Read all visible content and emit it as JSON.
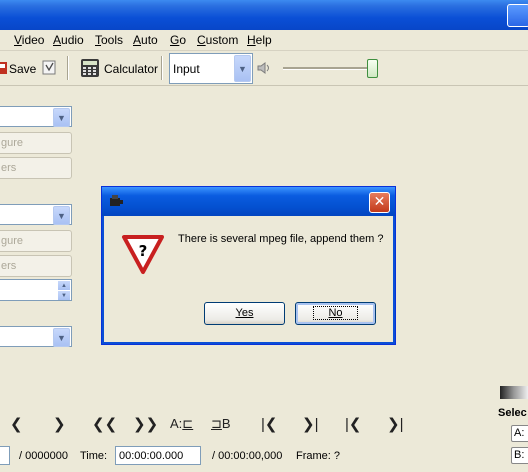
{
  "menu": {
    "items": [
      {
        "key": "V",
        "rest": "ideo"
      },
      {
        "key": "A",
        "rest": "udio"
      },
      {
        "key": "T",
        "rest": "ools"
      },
      {
        "key": "A",
        "rest": "uto"
      },
      {
        "key": "G",
        "rest": "o"
      },
      {
        "key": "C",
        "rest": "ustom"
      },
      {
        "key": "H",
        "rest": "elp"
      }
    ]
  },
  "toolbar": {
    "save_label": "Save",
    "calculator_label": "Calculator",
    "input_select_value": "Input"
  },
  "left_panel": {
    "configure_1": "gure",
    "filters_1": "ers",
    "configure_2": "gure",
    "filters_2": "ers"
  },
  "bottom": {
    "frame_total": "/ 0000000",
    "time_label": "Time:",
    "time_value": "00:00:00.000",
    "time_total": "/ 00:00:00,000",
    "frame_label": "Frame: ?",
    "selection_label": "Selec",
    "a_label": "A:",
    "b_label": "B:",
    "a_marker_label": "A:",
    "b_marker_label": "B"
  },
  "dialog": {
    "message": "There is several mpeg file, append them ?",
    "yes_label": "Yes",
    "no_label": "No",
    "close_glyph": "✕"
  }
}
